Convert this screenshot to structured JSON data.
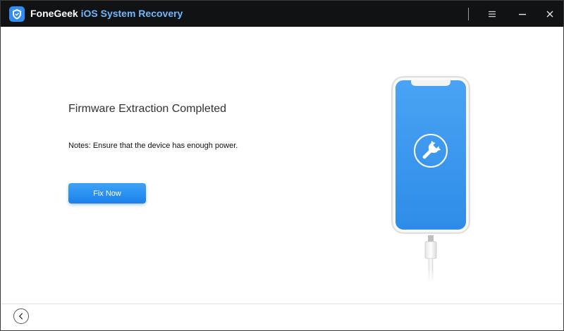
{
  "window": {
    "brand": "FoneGeek",
    "product": "iOS System Recovery",
    "logo_icon": "shield-icon",
    "controls": [
      "menu-icon",
      "minimize-icon",
      "close-icon"
    ]
  },
  "main": {
    "heading": "Firmware Extraction Completed",
    "notes": "Notes: Ensure that the device has enough power.",
    "fix_button_label": "Fix Now",
    "illustration": "iphone-with-cable",
    "screen_icon": "wrench-icon"
  },
  "footer": {
    "back_icon": "chevron-left-icon"
  },
  "colors": {
    "titlebar": "#111214",
    "product_accent": "#6fb8ff",
    "button": "#2b8ff0",
    "phone_screen": "#3d9af0"
  }
}
